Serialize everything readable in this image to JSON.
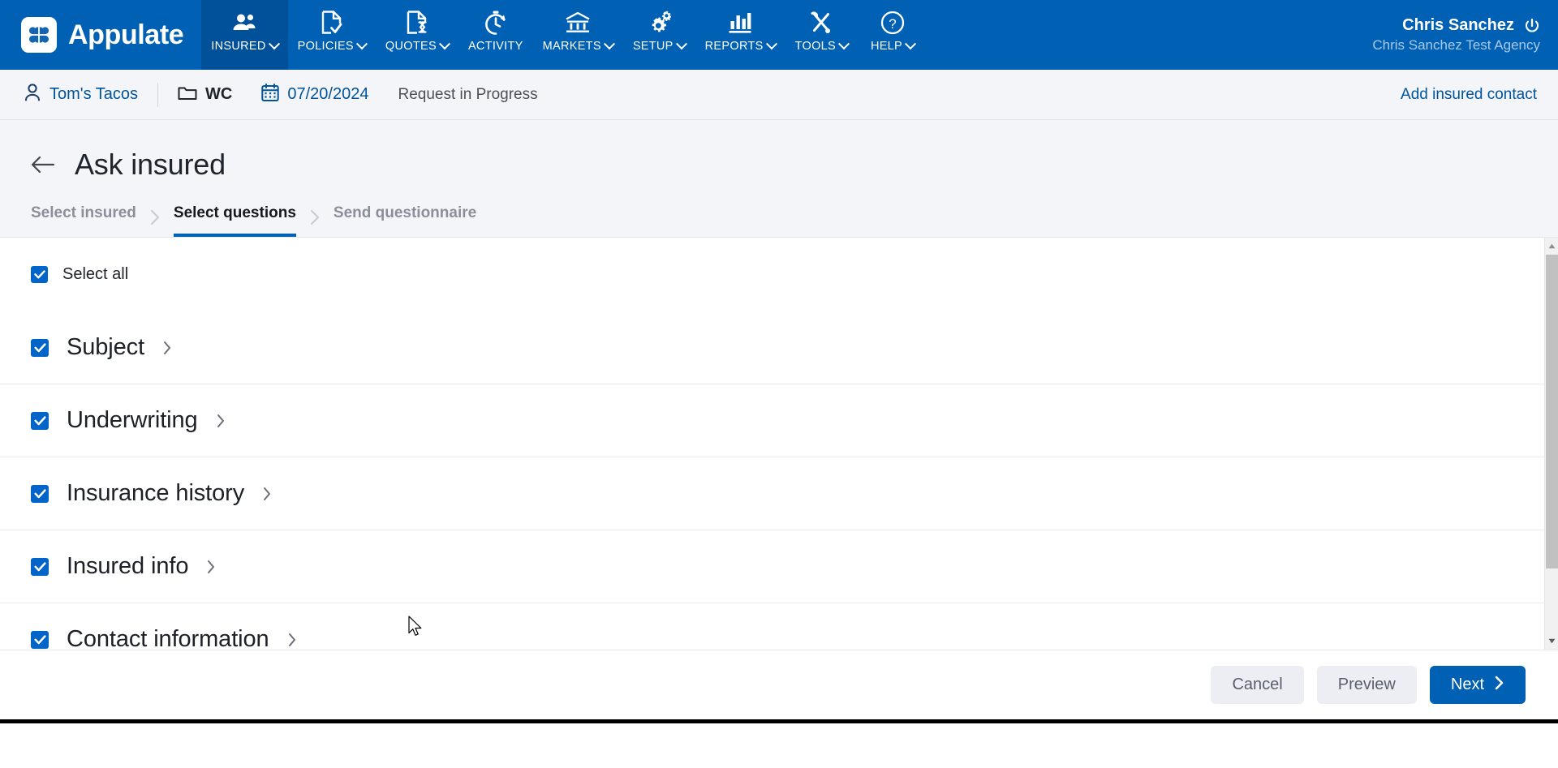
{
  "brand": {
    "name": "Appulate",
    "logo_icon": "clover-logo-icon"
  },
  "topnav": {
    "items": [
      {
        "label": "INSURED",
        "icon": "users-icon",
        "has_caret": true,
        "active": true
      },
      {
        "label": "POLICIES",
        "icon": "doc-check-icon",
        "has_caret": true,
        "active": false
      },
      {
        "label": "QUOTES",
        "icon": "doc-hourglass-icon",
        "has_caret": true,
        "active": false
      },
      {
        "label": "ACTIVITY",
        "icon": "stopwatch-icon",
        "has_caret": false,
        "active": false
      },
      {
        "label": "MARKETS",
        "icon": "bank-icon",
        "has_caret": true,
        "active": false
      },
      {
        "label": "SETUP",
        "icon": "gears-icon",
        "has_caret": true,
        "active": false
      },
      {
        "label": "REPORTS",
        "icon": "bar-chart-icon",
        "has_caret": true,
        "active": false
      },
      {
        "label": "TOOLS",
        "icon": "wrench-screwdriver-icon",
        "has_caret": true,
        "active": false
      },
      {
        "label": "HELP",
        "icon": "question-circle-icon",
        "has_caret": true,
        "active": false
      }
    ],
    "user": {
      "name": "Chris Sanchez",
      "agency": "Chris Sanchez Test Agency",
      "logout_icon": "power-icon"
    }
  },
  "insured_bar": {
    "insured_icon": "person-icon",
    "insured_name": "Tom's Tacos",
    "folder_icon": "folder-icon",
    "line_of_business": "WC",
    "calendar_icon": "calendar-icon",
    "effective_date": "07/20/2024",
    "status": "Request in Progress",
    "action_link": "Add insured contact"
  },
  "page": {
    "back_icon": "arrow-left-icon",
    "title": "Ask insured",
    "steps": [
      {
        "label": "Select insured",
        "active": false
      },
      {
        "label": "Select questions",
        "active": true
      },
      {
        "label": "Send questionnaire",
        "active": false
      }
    ],
    "step_separator_icon": "chevron-right-icon"
  },
  "questions": {
    "select_all_label": "Select all",
    "select_all_checked": true,
    "groups": [
      {
        "label": "Subject",
        "checked": true,
        "chevron_icon": "chevron-right-icon"
      },
      {
        "label": "Underwriting",
        "checked": true,
        "chevron_icon": "chevron-right-icon"
      },
      {
        "label": "Insurance history",
        "checked": true,
        "chevron_icon": "chevron-right-icon"
      },
      {
        "label": "Insured info",
        "checked": true,
        "chevron_icon": "chevron-right-icon"
      },
      {
        "label": "Contact information",
        "checked": true,
        "chevron_icon": "chevron-right-icon"
      }
    ]
  },
  "scrollbar": {
    "up_icon": "caret-up-icon",
    "down_icon": "caret-down-icon"
  },
  "footer": {
    "cancel_label": "Cancel",
    "preview_label": "Preview",
    "next_label": "Next",
    "next_icon": "chevron-right-icon"
  },
  "colors": {
    "brand_blue": "#0060b3",
    "nav_active": "#01509a",
    "link_blue": "#00549b",
    "checkbox_blue": "#0064c8",
    "page_bg": "#f4f5f9"
  }
}
